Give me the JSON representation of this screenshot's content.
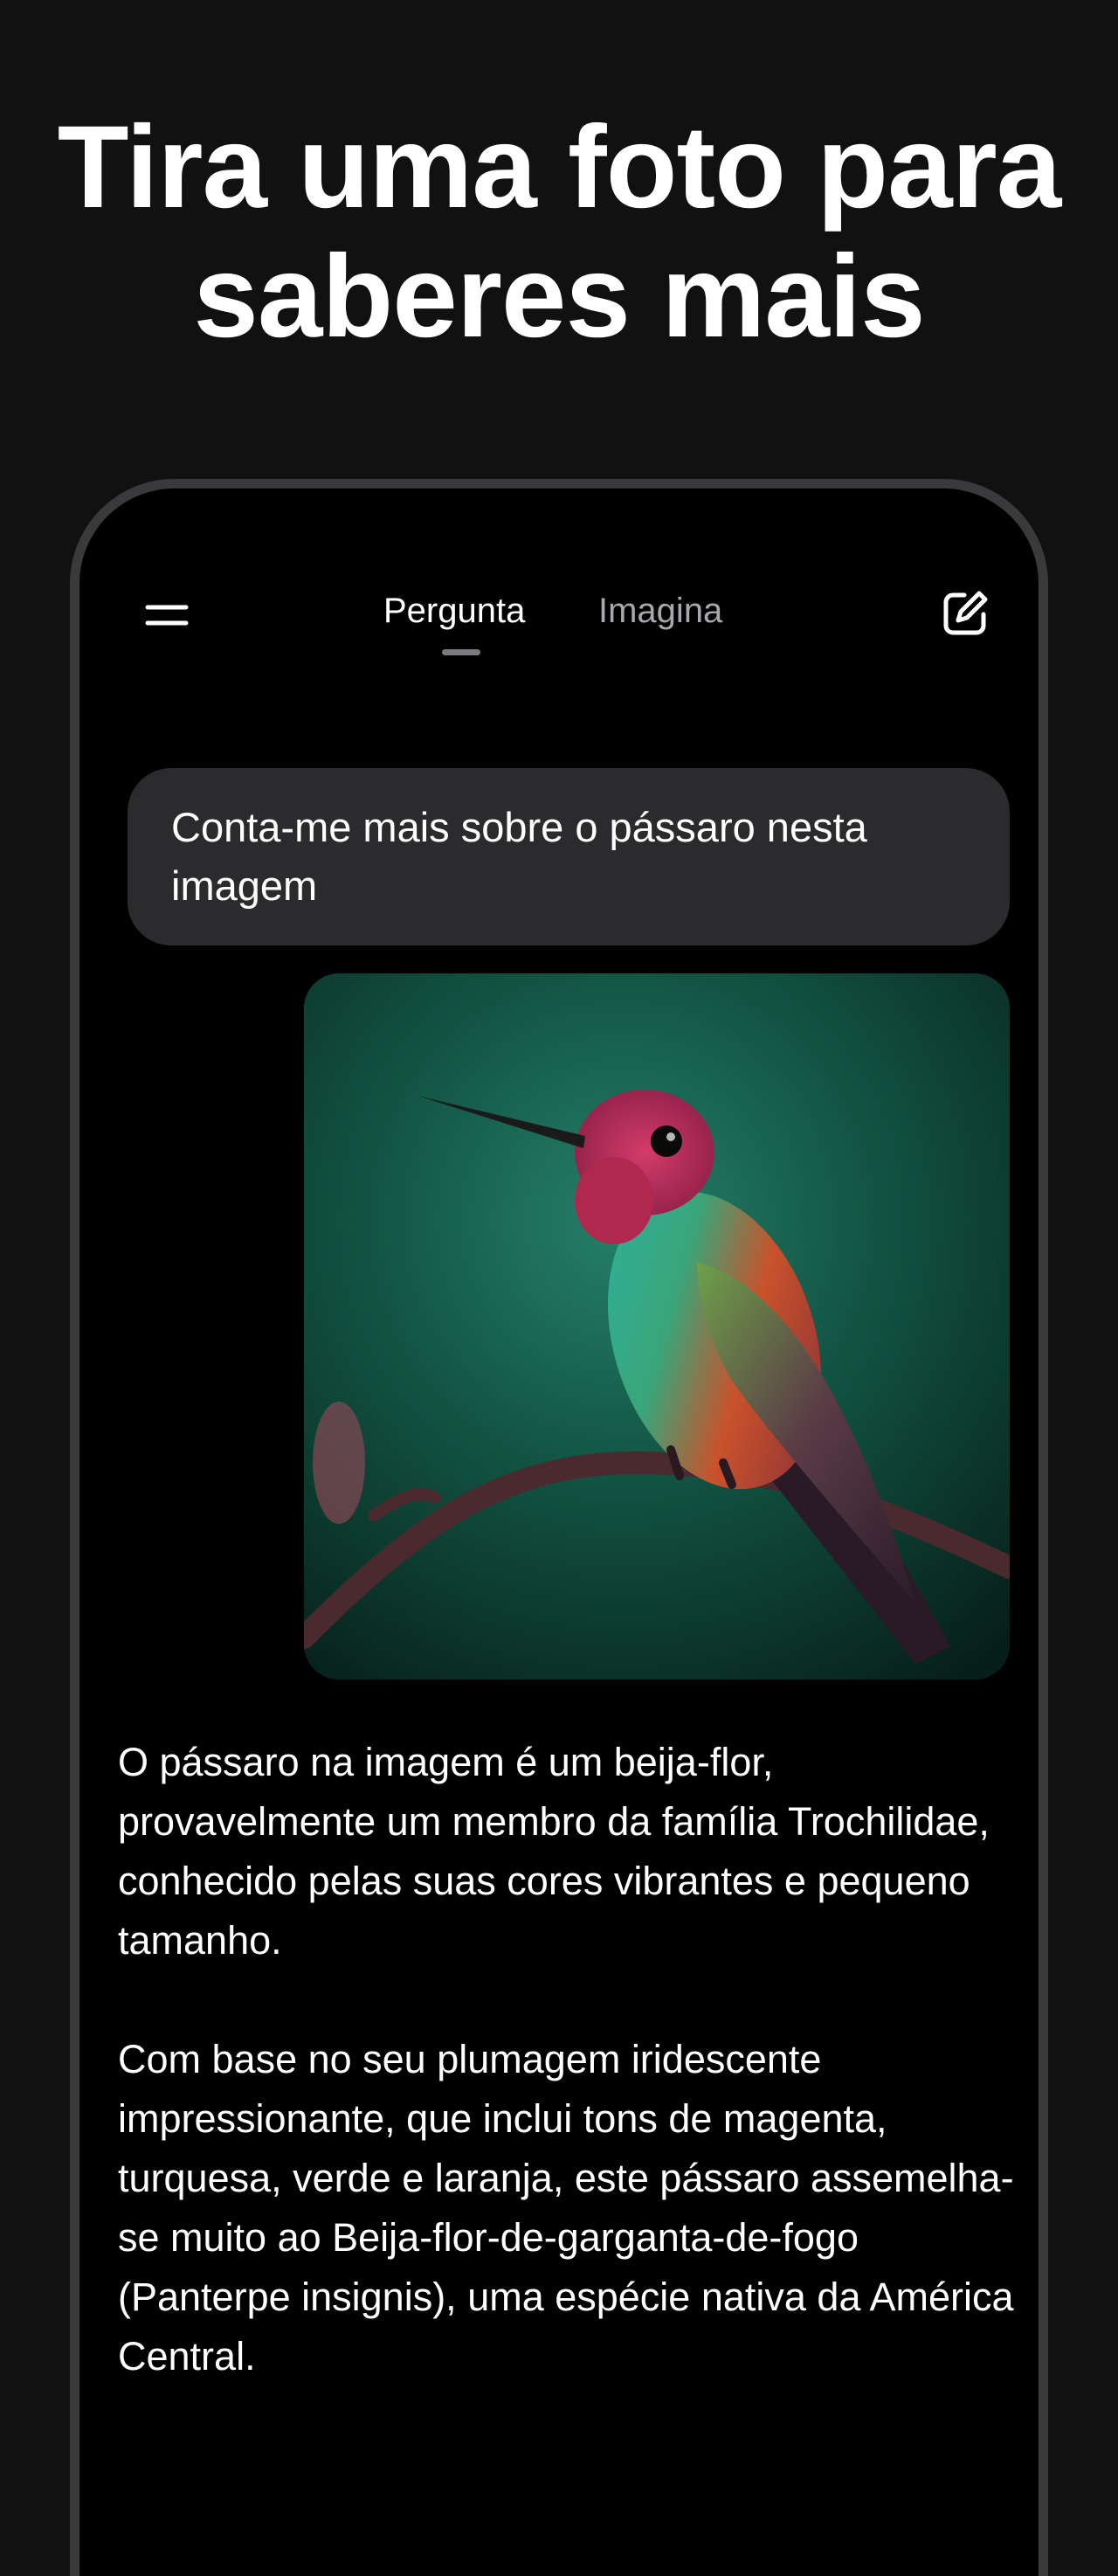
{
  "headline": {
    "line1": "Tira uma foto para",
    "line2": "saberes mais"
  },
  "topbar": {
    "menu_icon": "menu-icon",
    "tabs": [
      {
        "label": "Pergunta",
        "active": true
      },
      {
        "label": "Imagina",
        "active": false
      }
    ],
    "edit_icon": "edit-icon"
  },
  "chat": {
    "user_message": "Conta-me mais sobre o pássaro nesta imagem",
    "image_subject": "hummingbird",
    "response_paragraphs": [
      "O pássaro na imagem é um beija-flor, provavelmente um membro da família Trochilidae, conhecido pelas suas cores vibrantes e pequeno tamanho.",
      "Com base no seu plumagem iridescente impressionante, que inclui tons de magenta, turquesa, verde e laranja, este pássaro assemelha-se muito ao Beija-flor-de-garganta-de-fogo (Panterpe insignis), uma espécie nativa da América Central."
    ]
  },
  "colors": {
    "page_background": "#111111",
    "phone_background": "#000000",
    "bubble_background": "#2b2b2e",
    "active_tab": "#ffffff",
    "inactive_tab": "#a8a8ad"
  }
}
